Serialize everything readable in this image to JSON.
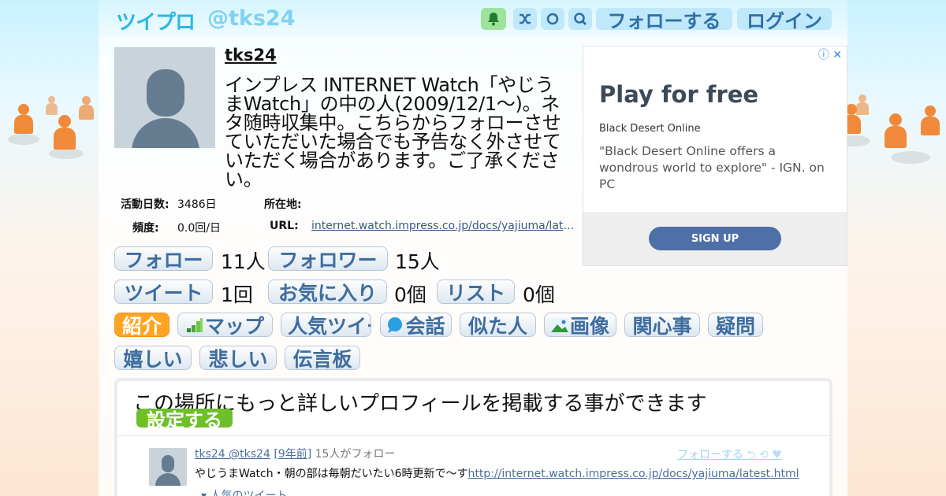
{
  "header": {
    "logo": "ツイプロ",
    "handle": "@tks24",
    "bell_icon": "bell-icon",
    "shuffle_icon": "shuffle-icon",
    "refresh_icon": "refresh-icon",
    "search_icon": "search-icon",
    "follow_label": "フォローする",
    "login_label": "ログイン"
  },
  "profile": {
    "username": "tks24",
    "bio": "インプレス INTERNET Watch「やじうまWatch」の中の人(2009/12/1～)。ネタ随時収集中。こちらからフォローさせていただいた場合でも予告なく外させていただく場合があります。ご了承ください。",
    "info": {
      "days_label": "活動日数:",
      "days_value": "3486日",
      "location_label": "所在地:",
      "location_value": "",
      "frequency_label": "頻度:",
      "frequency_value": "0.0回/日",
      "url_label": "URL:",
      "url_value": "internet.watch.impress.co.jp/docs/yajiuma/latest.html"
    }
  },
  "stats": {
    "following_label": "フォロー",
    "following_count": "11人",
    "followers_label": "フォロワー",
    "followers_count": "15人",
    "tweets_label": "ツイート",
    "tweets_count": "1回",
    "favorites_label": "お気に入り",
    "favorites_count": "0個",
    "lists_label": "リスト",
    "lists_count": "0個"
  },
  "tabs": [
    {
      "label": "紹介",
      "active": true
    },
    {
      "label": "マップ",
      "icon": "map-icon"
    },
    {
      "label": "人気ツイート",
      "icon": "heart-icon"
    },
    {
      "label": "会話",
      "icon": "speech-bubble-icon"
    },
    {
      "label": "似た人"
    },
    {
      "label": "画像",
      "icon": "image-icon"
    },
    {
      "label": "関心事"
    },
    {
      "label": "疑問"
    },
    {
      "label": "嬉しい"
    },
    {
      "label": "悲しい"
    },
    {
      "label": "伝言板"
    }
  ],
  "panel": {
    "message": "この場所にもっと詳しいプロフィールを掲載する事ができます",
    "setup_label": "設定する"
  },
  "tweet": {
    "author": "tks24 @tks24",
    "time": "[9年前]",
    "followers": "15人がフォロー",
    "text": "やじうまWatch・朝の部は毎朝だいたい6時更新で～す",
    "link": "http://internet.watch.impress.co.jp/docs/yajiuma/latest.html",
    "follow_label": "フォローする",
    "popular_label": "人気のツイート"
  },
  "ad": {
    "title": "Play for free",
    "sponsor": "Black Desert Online",
    "quote": "\"Black Desert Online offers a wondrous world to explore\" - IGN. on PC",
    "cta": "SIGN UP"
  },
  "colors": {
    "accent": "#2bb7e6",
    "active_tab": "#ffa423",
    "setup_button": "#6ebf2a",
    "ad_button": "#4f6fa8"
  }
}
